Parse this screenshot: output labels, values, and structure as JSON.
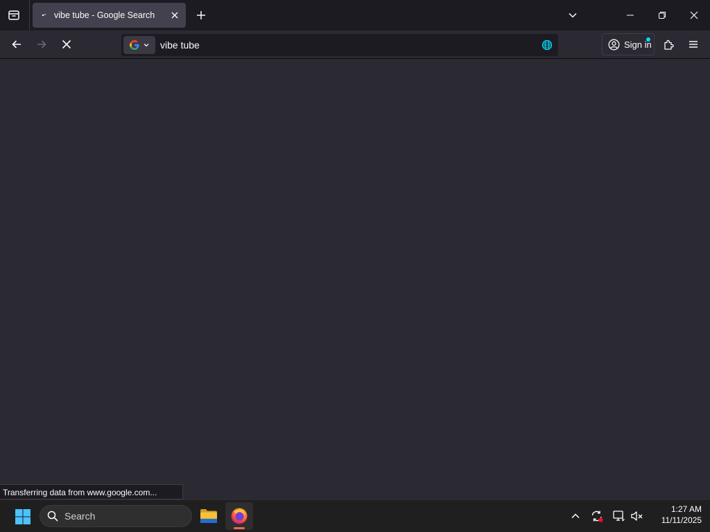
{
  "browser": {
    "tab": {
      "title": "vibe tube - Google Search"
    },
    "urlbar": {
      "value": "vibe tube",
      "search_engine": "Google"
    },
    "account": {
      "sign_in_label": "Sign in"
    },
    "status_text": "Transferring data from www.google.com..."
  },
  "taskbar": {
    "search_label": "Search",
    "apps": [
      "file-explorer",
      "firefox"
    ],
    "active_app": "firefox",
    "clock": {
      "time": "1:27 AM",
      "date": "11/11/2025"
    }
  },
  "colors": {
    "content_bg": "#2b2a33",
    "tabstrip_bg": "#1c1b22",
    "accent": "#00ddff",
    "taskbar_bg": "#1f1f1f"
  }
}
